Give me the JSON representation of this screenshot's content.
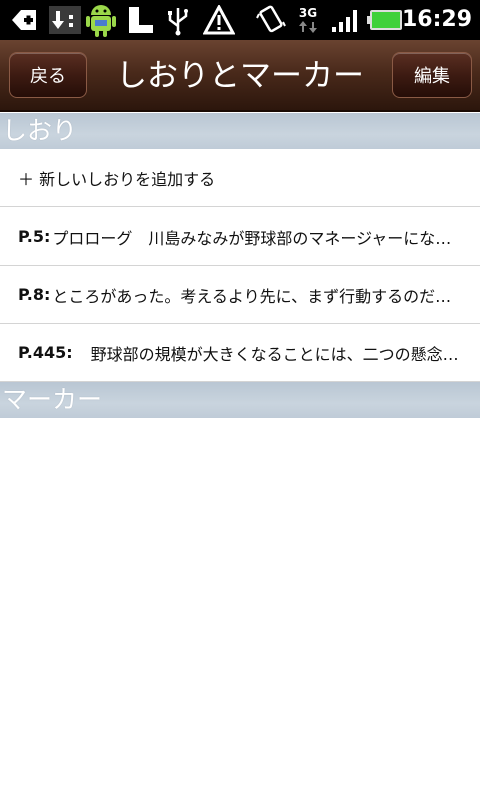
{
  "status_bar": {
    "time": "16:29",
    "network": "3G",
    "icons": [
      "add-icon",
      "download-icon",
      "android-icon",
      "sd-card-icon",
      "usb-icon",
      "warning-icon",
      "vibrate-icon",
      "network-3g-icon",
      "signal-icon",
      "battery-icon"
    ]
  },
  "title_bar": {
    "back_label": "戻る",
    "title": "しおりとマーカー",
    "edit_label": "編集"
  },
  "bookmarks_section": {
    "header": "しおり",
    "add_label": "＋ 新しいしおりを追加する",
    "items": [
      {
        "page": "P.5:",
        "text": "プロローグ　川島みなみが野球部のマネージャーにな…"
      },
      {
        "page": "P.8:",
        "text": "ところがあった。考えるより先に、まず行動するのだ…"
      },
      {
        "page": "P.445:",
        "text": "　野球部の規模が大きくなることには、二つの懸念…"
      }
    ]
  },
  "markers_section": {
    "header": "マーカー"
  },
  "colors": {
    "titlebar_brown": "#4a2a1b",
    "section_header_blue": "#c2ceda",
    "status_bar": "#000000",
    "battery_green": "#3fd13a"
  }
}
